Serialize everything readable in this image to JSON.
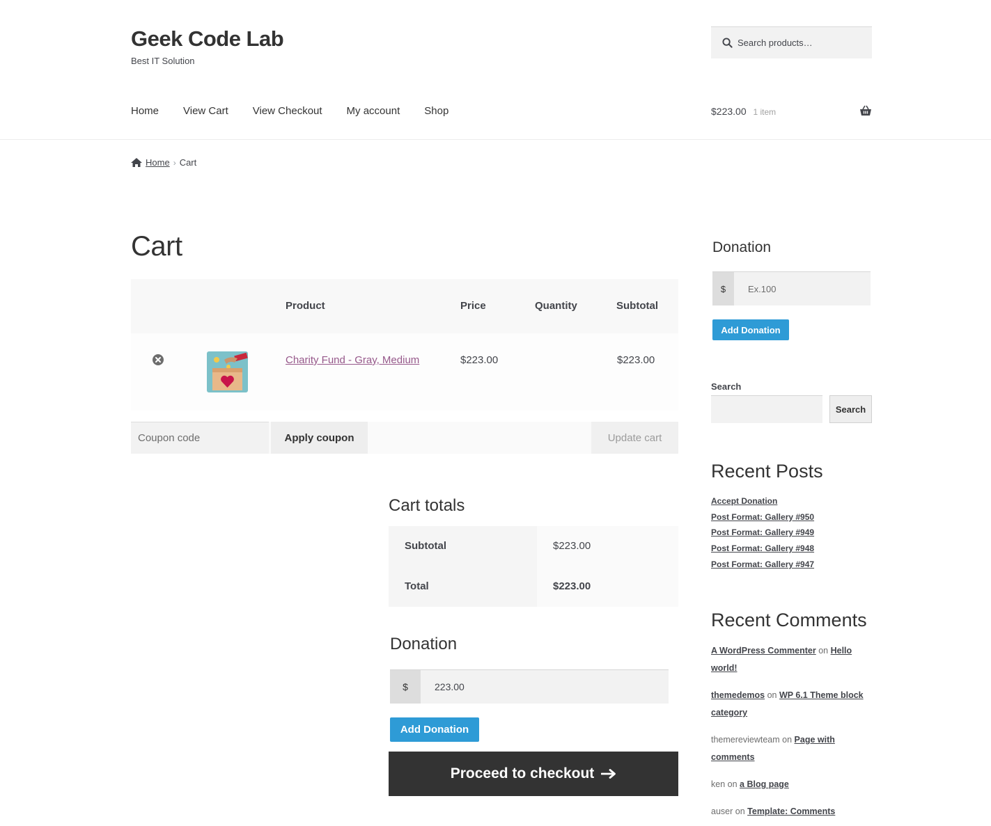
{
  "site": {
    "title": "Geek Code Lab",
    "tagline": "Best IT Solution"
  },
  "header_search": {
    "placeholder": "Search products…"
  },
  "nav": {
    "items": [
      "Home",
      "View Cart",
      "View Checkout",
      "My account",
      "Shop"
    ]
  },
  "mini_cart": {
    "amount": "$223.00",
    "count": "1 item"
  },
  "breadcrumb": {
    "home": "Home",
    "separator": "›",
    "current": "Cart"
  },
  "main": {
    "title": "Cart",
    "table": {
      "headers": {
        "product": "Product",
        "price": "Price",
        "quantity": "Quantity",
        "subtotal": "Subtotal"
      },
      "rows": [
        {
          "product": "Charity Fund - Gray, Medium",
          "price": "$223.00",
          "subtotal": "$223.00"
        }
      ]
    },
    "coupon": {
      "placeholder": "Coupon code",
      "apply_label": "Apply coupon",
      "update_label": "Update cart"
    },
    "totals": {
      "title": "Cart totals",
      "subtotal_label": "Subtotal",
      "subtotal_value": "$223.00",
      "total_label": "Total",
      "total_value": "$223.00"
    },
    "donation": {
      "title": "Donation",
      "currency": "$",
      "value": "223.00",
      "button": "Add Donation"
    },
    "checkout_label": "Proceed to checkout"
  },
  "sidebar": {
    "donation": {
      "title": "Donation",
      "currency": "$",
      "placeholder": "Ex.100",
      "button": "Add Donation"
    },
    "search": {
      "label": "Search",
      "button": "Search"
    },
    "recent_posts": {
      "title": "Recent Posts",
      "items": [
        "Accept Donation",
        "Post Format: Gallery #950",
        "Post Format: Gallery #949",
        "Post Format: Gallery #948",
        "Post Format: Gallery #947"
      ]
    },
    "recent_comments": {
      "title": "Recent Comments",
      "on": "on",
      "items": [
        {
          "author": "A WordPress Commenter",
          "post": "Hello world!"
        },
        {
          "author": "themedemos",
          "post": "WP 6.1 Theme block category"
        },
        {
          "author": "themereviewteam",
          "post": "Page with comments"
        },
        {
          "author": "ken",
          "post": "a Blog page"
        },
        {
          "author": "auser",
          "post": "Template: Comments"
        }
      ]
    }
  },
  "colors": {
    "accent_blue": "#2e9bd6",
    "link_purple": "#96588a",
    "dark_button": "#333333"
  }
}
